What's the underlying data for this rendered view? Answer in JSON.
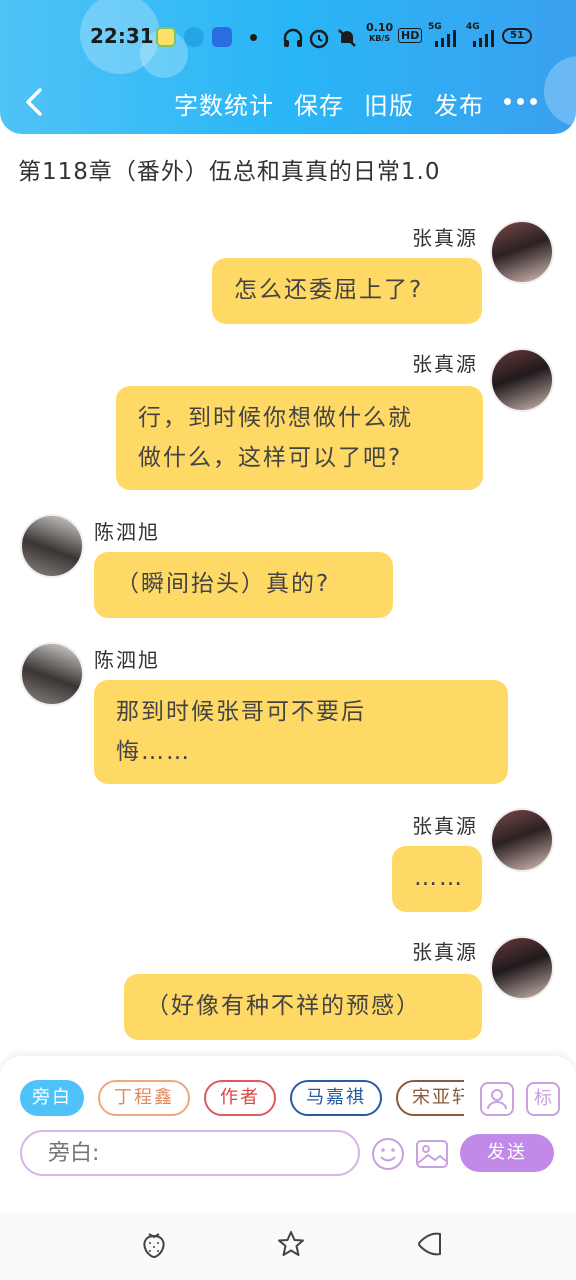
{
  "status_bar": {
    "time": "22:31",
    "net_speed": "0.10",
    "net_unit": "KB/S",
    "hd": "HD",
    "signal1": "5G",
    "signal2": "4G",
    "battery": "51"
  },
  "nav": {
    "word_count": "字数统计",
    "save": "保存",
    "old_version": "旧版",
    "publish": "发布"
  },
  "chapter_title": "第118章（番外）伍总和真真的日常1.0",
  "messages": [
    {
      "name": "张真源",
      "text": "怎么还委屈上了?"
    },
    {
      "name": "张真源",
      "line1": "行，到时候你想做什么就",
      "line2": "做什么，这样可以了吧?"
    },
    {
      "name": "陈泗旭",
      "text": "（瞬间抬头）真的?"
    },
    {
      "name": "陈泗旭",
      "line1": "那到时候张哥可不要后",
      "line2": "悔……"
    },
    {
      "name": "张真源",
      "text": "……"
    },
    {
      "name": "张真源",
      "text": "（好像有种不祥的预感）"
    }
  ],
  "chips": [
    "旁白",
    "丁程鑫",
    "作者",
    "马嘉祺",
    "宋亚轩"
  ],
  "input": {
    "placeholder": "旁白:"
  },
  "send_label": "发送",
  "tools": {
    "role_icon_label": "",
    "tag_label": "标"
  },
  "colors": {
    "header": "#29b6f6",
    "bubble": "#ffd966",
    "accent_purple": "#c28ae8",
    "chip_selected": "#4fc3f7"
  }
}
